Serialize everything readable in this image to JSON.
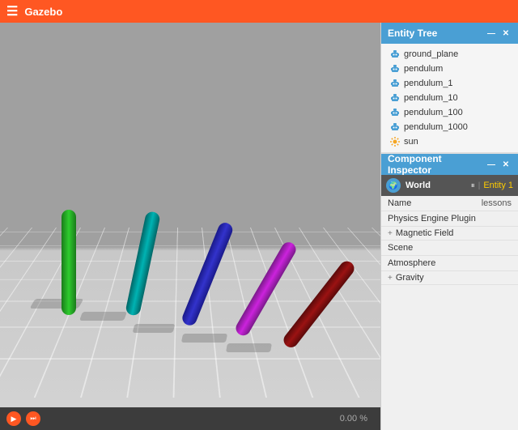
{
  "topbar": {
    "title": "Gazebo",
    "menu_icon": "☰"
  },
  "entity_tree": {
    "panel_title": "Entity Tree",
    "minimize_icon": "—",
    "close_icon": "✕",
    "entities": [
      {
        "name": "ground_plane",
        "icon": "robot"
      },
      {
        "name": "pendulum",
        "icon": "robot"
      },
      {
        "name": "pendulum_1",
        "icon": "robot"
      },
      {
        "name": "pendulum_10",
        "icon": "robot"
      },
      {
        "name": "pendulum_100",
        "icon": "robot"
      },
      {
        "name": "pendulum_1000",
        "icon": "robot"
      },
      {
        "name": "sun",
        "icon": "sun"
      }
    ]
  },
  "component_inspector": {
    "panel_title": "Component Inspector",
    "minimize_icon": "—",
    "close_icon": "✕",
    "world_label": "World",
    "entity_label": "Entity 1",
    "world_icon": "W",
    "rows": [
      {
        "label": "Name",
        "value": "",
        "expandable": false
      },
      {
        "label": "Physics Engine Plugin",
        "value": "",
        "expandable": false
      },
      {
        "label": "Magnetic Field",
        "value": "",
        "expandable": true,
        "prefix": "+"
      },
      {
        "label": "Scene",
        "value": "",
        "expandable": false
      },
      {
        "label": "Atmosphere",
        "value": "",
        "expandable": false
      },
      {
        "label": "Gravity",
        "value": "",
        "expandable": true,
        "prefix": "+"
      }
    ],
    "name_value": "lessons"
  },
  "statusbar": {
    "play_icon": "▶",
    "step_icon": "⏭",
    "zoom_label": "0.00 %"
  },
  "cylinders": [
    {
      "id": "cyl1",
      "color_label": "green"
    },
    {
      "id": "cyl2",
      "color_label": "teal"
    },
    {
      "id": "cyl3",
      "color_label": "blue"
    },
    {
      "id": "cyl4",
      "color_label": "purple"
    },
    {
      "id": "cyl5",
      "color_label": "dark-red"
    }
  ]
}
